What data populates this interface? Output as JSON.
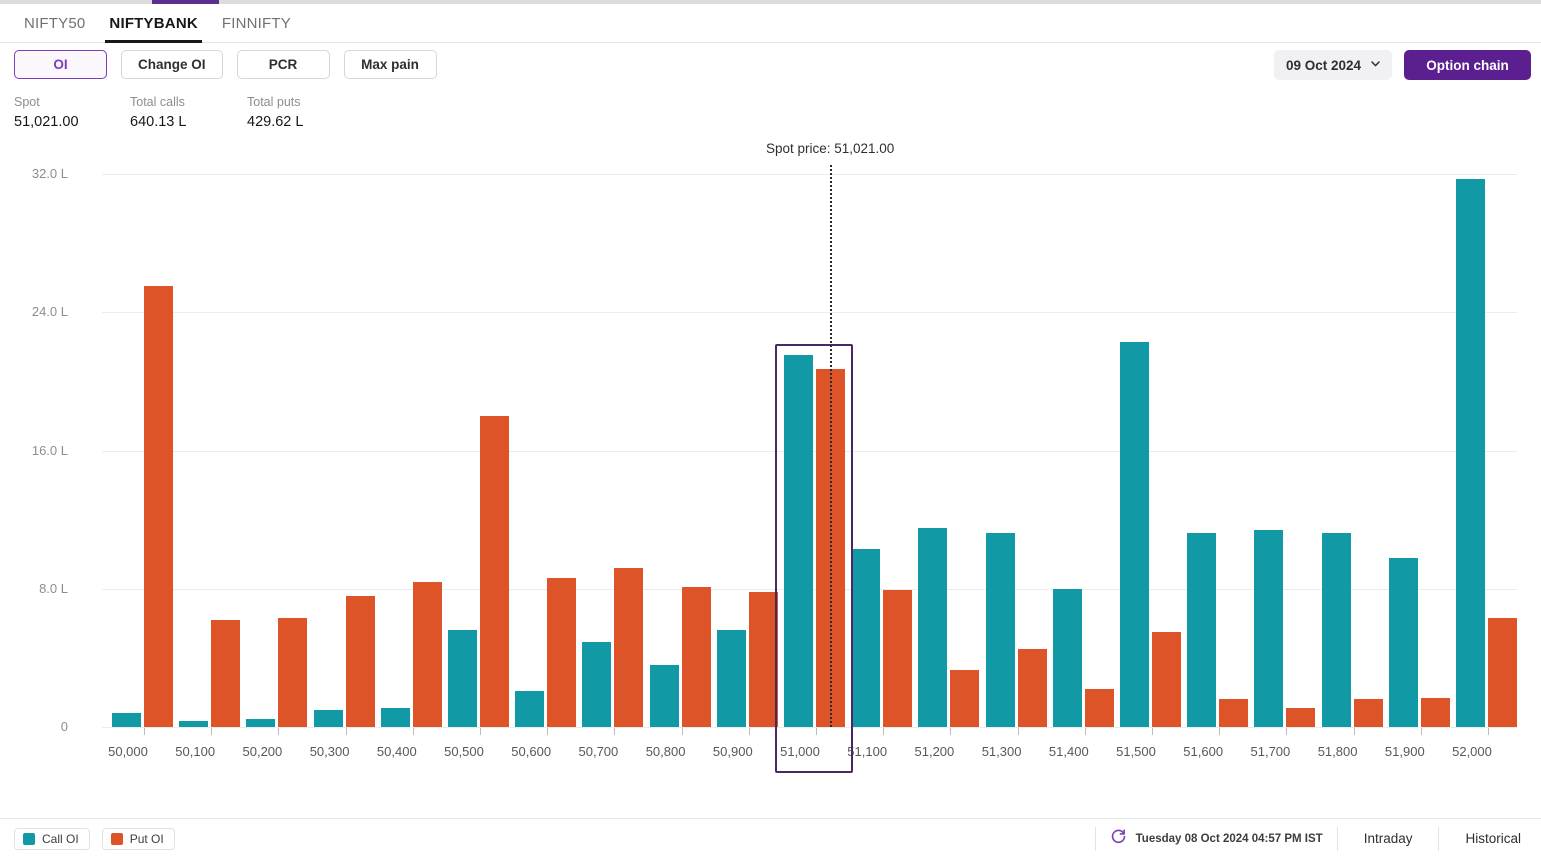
{
  "tabs": [
    {
      "label": "NIFTY50",
      "active": false
    },
    {
      "label": "NIFTYBANK",
      "active": true
    },
    {
      "label": "FINNIFTY",
      "active": false
    }
  ],
  "toolbar": {
    "metrics": [
      {
        "label": "OI",
        "selected": true
      },
      {
        "label": "Change OI",
        "selected": false
      },
      {
        "label": "PCR",
        "selected": false
      },
      {
        "label": "Max pain",
        "selected": false
      }
    ],
    "expiry_value": "09 Oct 2024",
    "chevron_icon": "chevron-down-icon",
    "option_chain_label": "Option chain"
  },
  "stats": [
    {
      "label": "Spot",
      "value": "51,021.00"
    },
    {
      "label": "Total calls",
      "value": "640.13 L"
    },
    {
      "label": "Total puts",
      "value": "429.62 L"
    }
  ],
  "footer": {
    "legend": [
      {
        "label": "Call OI",
        "color": "#119aa5"
      },
      {
        "label": "Put OI",
        "color": "#dd5429"
      }
    ],
    "refresh_icon": "refresh-icon",
    "timestamp": "Tuesday 08 Oct 2024 04:57 PM IST",
    "links": [
      {
        "label": "Intraday",
        "active": true
      },
      {
        "label": "Historical",
        "active": false
      }
    ]
  },
  "colors": {
    "call": "#119aa5",
    "put": "#dd5429",
    "brand": "#5b1f90",
    "accent": "#7b3fb5",
    "highlight": "#4a2764"
  },
  "chart_data": {
    "type": "bar",
    "title": "",
    "xlabel": "",
    "ylabel": "",
    "ylim": [
      0,
      32
    ],
    "yticks": [
      "0",
      "8.0 L",
      "16.0 L",
      "24.0 L",
      "32.0 L"
    ],
    "ytick_values": [
      0,
      8,
      16,
      24,
      32
    ],
    "grid": true,
    "legend_position": "bottom-left",
    "annotation": {
      "label": "Spot price: 51,021.00",
      "value": 51021,
      "style": "dotted-vertical"
    },
    "highlighted_category": "51,000",
    "categories": [
      "50,000",
      "50,100",
      "50,200",
      "50,300",
      "50,400",
      "50,500",
      "50,600",
      "50,700",
      "50,800",
      "50,900",
      "51,000",
      "51,100",
      "51,200",
      "51,300",
      "51,400",
      "51,500",
      "51,600",
      "51,700",
      "51,800",
      "51,900",
      "52,000"
    ],
    "series": [
      {
        "name": "Call OI",
        "color": "#119aa5",
        "values": [
          0.8,
          0.35,
          0.45,
          1.0,
          1.1,
          5.6,
          2.1,
          4.9,
          3.6,
          5.6,
          21.5,
          10.3,
          11.5,
          11.2,
          8.0,
          22.3,
          11.2,
          11.4,
          11.2,
          9.8,
          31.7
        ]
      },
      {
        "name": "Put OI",
        "color": "#dd5429",
        "values": [
          25.5,
          6.2,
          6.3,
          7.6,
          8.4,
          18.0,
          8.6,
          9.2,
          8.1,
          7.8,
          20.7,
          7.9,
          3.3,
          4.5,
          2.2,
          5.5,
          1.6,
          1.1,
          1.6,
          1.7,
          6.3
        ]
      }
    ]
  }
}
